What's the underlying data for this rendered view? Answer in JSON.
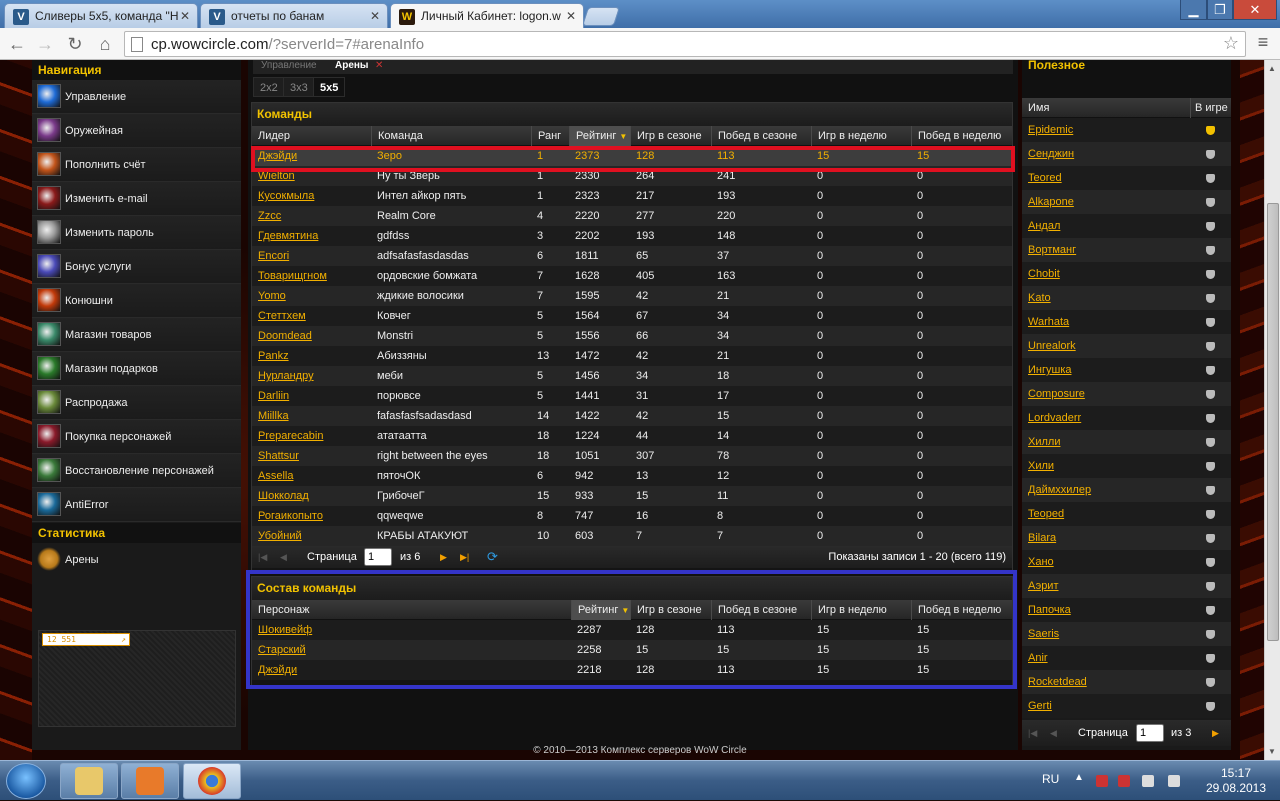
{
  "browser": {
    "tabs": [
      {
        "title": "Сливеры 5x5, команда \"Н",
        "favicon": "wowcircle-favicon"
      },
      {
        "title": "отчеты по банам",
        "favicon": "wowcircle-favicon"
      },
      {
        "title": "Личный Кабинет: logon.w",
        "favicon": "wow-favicon",
        "active": true
      }
    ],
    "url_host": "cp.wowcircle.com",
    "url_rest": "/?serverId=7#arenaInfo"
  },
  "nav": {
    "heading": "Навигация",
    "items": [
      {
        "label": "Управление",
        "color": "#1e6bd6"
      },
      {
        "label": "Оружейная",
        "color": "#7a3a8a"
      },
      {
        "label": "Пополнить счёт",
        "color": "#c2541a"
      },
      {
        "label": "Изменить e-mail",
        "color": "#8a1a1a"
      },
      {
        "label": "Изменить пароль",
        "color": "#9a9a9a"
      },
      {
        "label": "Бонус услуги",
        "color": "#4a4ab8"
      },
      {
        "label": "Конюшни",
        "color": "#c23a0a"
      },
      {
        "label": "Магазин товаров",
        "color": "#3a8a6a"
      },
      {
        "label": "Магазин подарков",
        "color": "#2a7a2a"
      },
      {
        "label": "Распродажа",
        "color": "#6a8a3a"
      },
      {
        "label": "Покупка персонажей",
        "color": "#8a1a2a"
      },
      {
        "label": "Восстановление персонажей",
        "color": "#3a7a3a"
      },
      {
        "label": "AntiError",
        "color": "#1a6a9a"
      }
    ],
    "stats_heading": "Статистика",
    "stats_items": [
      {
        "label": "Арены",
        "color": "#b87a1a"
      }
    ],
    "rating_badge": "12 551"
  },
  "main": {
    "page_tabs": [
      "Управление",
      "Арены"
    ],
    "subtabs": [
      "2x2",
      "3x3",
      "5x5"
    ],
    "teams": {
      "title": "Команды",
      "columns": [
        "Лидер",
        "Команда",
        "Ранг",
        "Рейтинг",
        "Игр в сезоне",
        "Побед в сезоне",
        "Игр в неделю",
        "Побед в неделю"
      ],
      "rows": [
        [
          "Джэйди",
          "Зеро",
          "1",
          "2373",
          "128",
          "113",
          "15",
          "15"
        ],
        [
          "Wielton",
          "Ну ты Зверь",
          "1",
          "2330",
          "264",
          "241",
          "0",
          "0"
        ],
        [
          "Кусокмыла",
          "Интел айкор пять",
          "1",
          "2323",
          "217",
          "193",
          "0",
          "0"
        ],
        [
          "Zzcc",
          "Realm Core",
          "4",
          "2220",
          "277",
          "220",
          "0",
          "0"
        ],
        [
          "Гдевмятина",
          "gdfdss",
          "3",
          "2202",
          "193",
          "148",
          "0",
          "0"
        ],
        [
          "Encori",
          "adfsafasfasdasdas",
          "6",
          "1811",
          "65",
          "37",
          "0",
          "0"
        ],
        [
          "Товарищгном",
          "ордовские бомжата",
          "7",
          "1628",
          "405",
          "163",
          "0",
          "0"
        ],
        [
          "Yomo",
          "ждикие волосики",
          "7",
          "1595",
          "42",
          "21",
          "0",
          "0"
        ],
        [
          "Стеттхем",
          "Ковчег",
          "5",
          "1564",
          "67",
          "34",
          "0",
          "0"
        ],
        [
          "Doomdead",
          "Monstri",
          "5",
          "1556",
          "66",
          "34",
          "0",
          "0"
        ],
        [
          "Pankz",
          "Абиззяны",
          "13",
          "1472",
          "42",
          "21",
          "0",
          "0"
        ],
        [
          "Нурландру",
          "меби",
          "5",
          "1456",
          "34",
          "18",
          "0",
          "0"
        ],
        [
          "Darliin",
          "порювсе",
          "5",
          "1441",
          "31",
          "17",
          "0",
          "0"
        ],
        [
          "Miillka",
          "fafasfasfsadasdasd",
          "14",
          "1422",
          "42",
          "15",
          "0",
          "0"
        ],
        [
          "Preparecabin",
          "ататаатта",
          "18",
          "1224",
          "44",
          "14",
          "0",
          "0"
        ],
        [
          "Shattsur",
          "right between the eyes",
          "18",
          "1051",
          "307",
          "78",
          "0",
          "0"
        ],
        [
          "Assella",
          "пяточОК",
          "6",
          "942",
          "13",
          "12",
          "0",
          "0"
        ],
        [
          "Шокколад",
          "ГрибочеГ",
          "15",
          "933",
          "15",
          "11",
          "0",
          "0"
        ],
        [
          "Рогаикопыто",
          "qqweqwe",
          "8",
          "747",
          "16",
          "8",
          "0",
          "0"
        ],
        [
          "Убойний",
          "КРАБЫ АТАКУЮТ",
          "10",
          "603",
          "7",
          "7",
          "0",
          "0"
        ]
      ],
      "pager": {
        "page_label": "Страница",
        "page": "1",
        "of_label": "из 6",
        "summary": "Показаны записи 1 - 20 (всего 119)"
      }
    },
    "roster": {
      "title": "Состав команды",
      "columns": [
        "Персонаж",
        "Рейтинг",
        "Игр в сезоне",
        "Побед в сезоне",
        "Игр в неделю",
        "Побед в неделю"
      ],
      "rows": [
        [
          "Шокивейф",
          "2287",
          "128",
          "113",
          "15",
          "15"
        ],
        [
          "Старский",
          "2258",
          "15",
          "15",
          "15",
          "15"
        ],
        [
          "Джэйди",
          "2218",
          "128",
          "113",
          "15",
          "15"
        ]
      ]
    }
  },
  "useful": {
    "title": "Полезное",
    "columns": [
      "Имя",
      "В игре"
    ],
    "names": [
      "Epidemic",
      "Сенджин",
      "Teored",
      "Alkapone",
      "Андал",
      "Вортманг",
      "Chobit",
      "Kato",
      "Warhata",
      "Unrealork",
      "Ингушка",
      "Composure",
      "Lordvaderr",
      "Хилли",
      "Хили",
      "Даймххилер",
      "Teoped",
      "Bilara",
      "Хано",
      "Аэрит",
      "Папочка",
      "Saeris",
      "Anir",
      "Rocketdead",
      "Gerti"
    ],
    "online_first": true,
    "pager": {
      "page_label": "Страница",
      "page": "1",
      "of_label": "из 3"
    }
  },
  "footer": "© 2010—2013 Комплекс серверов WoW Circle",
  "taskbar": {
    "lang": "RU",
    "time": "15:17",
    "date": "29.08.2013"
  }
}
